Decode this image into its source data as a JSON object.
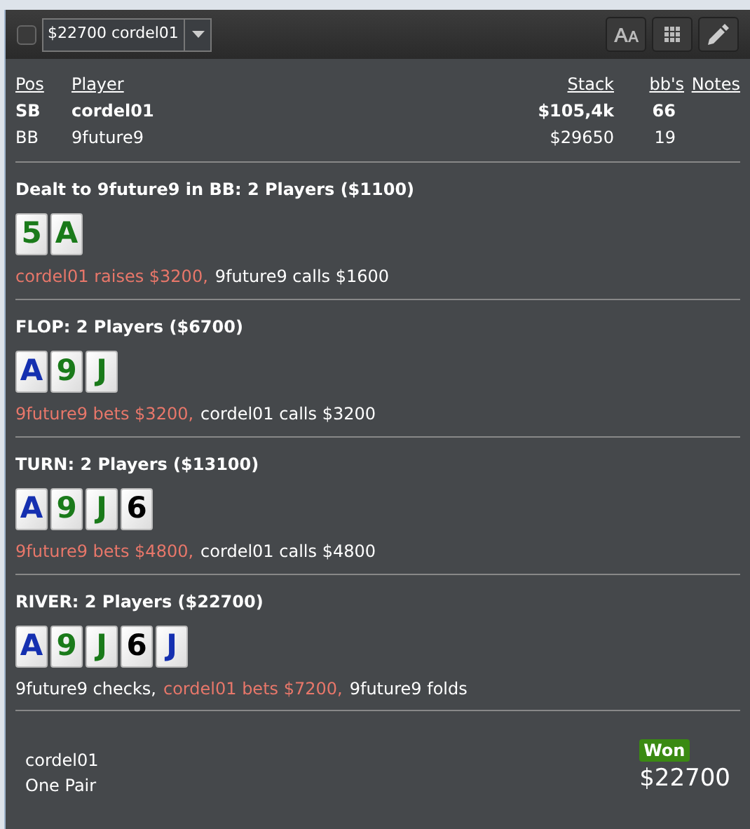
{
  "toolbar": {
    "select_checked": false,
    "hand_select": {
      "value": "$22700 cordel01"
    }
  },
  "players": {
    "columns": [
      "Pos",
      "Player",
      "Stack",
      "bb's",
      "Notes"
    ],
    "rows": [
      {
        "pos": "SB",
        "player": "cordel01",
        "stack": "$105,4k",
        "bbs": "66",
        "bold": true
      },
      {
        "pos": "BB",
        "player": "9future9",
        "stack": "$29650",
        "bbs": "19",
        "bold": false
      }
    ]
  },
  "streets": [
    {
      "title": "Dealt to 9future9 in BB: 2 Players ($1100)",
      "cards": [
        {
          "rank": "5",
          "color": "#1a7a1a"
        },
        {
          "rank": "A",
          "color": "#1a7a1a"
        }
      ],
      "actions": [
        {
          "text": "cordel01 raises $3200,",
          "kind": "aggressive"
        },
        {
          "text": "9future9 calls $1600",
          "kind": "passive"
        }
      ]
    },
    {
      "title": "FLOP: 2 Players ($6700)",
      "cards": [
        {
          "rank": "A",
          "color": "#1530b0"
        },
        {
          "rank": "9",
          "color": "#1a7a1a"
        },
        {
          "rank": "J",
          "color": "#1a7a1a"
        }
      ],
      "actions": [
        {
          "text": "9future9 bets $3200,",
          "kind": "aggressive"
        },
        {
          "text": "cordel01 calls $3200",
          "kind": "passive"
        }
      ]
    },
    {
      "title": "TURN: 2 Players ($13100)",
      "cards": [
        {
          "rank": "A",
          "color": "#1530b0"
        },
        {
          "rank": "9",
          "color": "#1a7a1a"
        },
        {
          "rank": "J",
          "color": "#1a7a1a"
        },
        {
          "rank": "6",
          "color": "#000000"
        }
      ],
      "actions": [
        {
          "text": "9future9 bets $4800,",
          "kind": "aggressive"
        },
        {
          "text": "cordel01 calls $4800",
          "kind": "passive"
        }
      ]
    },
    {
      "title": "RIVER: 2 Players ($22700)",
      "cards": [
        {
          "rank": "A",
          "color": "#1530b0"
        },
        {
          "rank": "9",
          "color": "#1a7a1a"
        },
        {
          "rank": "J",
          "color": "#1a7a1a"
        },
        {
          "rank": "6",
          "color": "#000000"
        },
        {
          "rank": "J",
          "color": "#1530b0"
        }
      ],
      "actions": [
        {
          "text": "9future9 checks,",
          "kind": "passive"
        },
        {
          "text": "cordel01 bets $7200,",
          "kind": "aggressive"
        },
        {
          "text": "9future9 folds",
          "kind": "passive"
        }
      ]
    }
  ],
  "result": {
    "player": "cordel01",
    "hand": "One Pair",
    "badge": "Won",
    "amount": "$22700"
  }
}
